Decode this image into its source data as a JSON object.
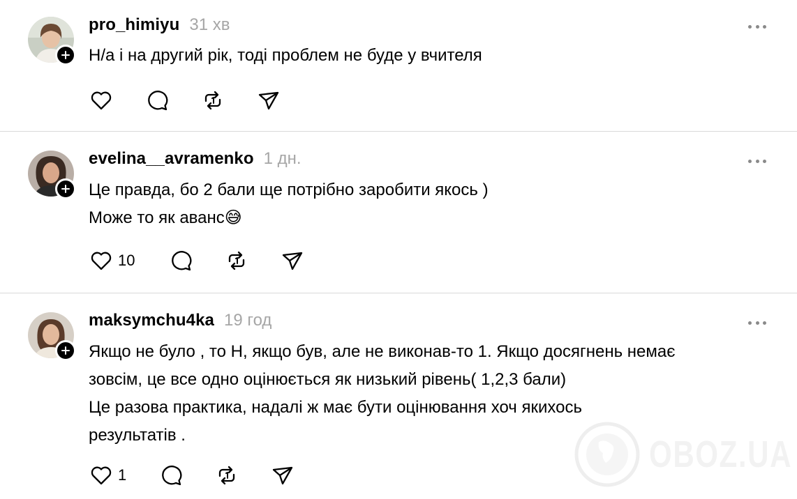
{
  "posts": [
    {
      "username": "pro_himiyu",
      "time": "31 хв",
      "lines": [
        "Н/а і на другий рік, тоді проблем не буде у вчителя"
      ],
      "likes": ""
    },
    {
      "username": "evelina__avramenko",
      "time": "1 дн.",
      "lines": [
        "Це правда, бо 2 бали ще потрібно заробити якось )",
        "Може то як аванс😅"
      ],
      "likes": "10"
    },
    {
      "username": "maksymchu4ka",
      "time": "19 год",
      "lines": [
        "Якщо не було , то Н, якщо був, але не виконав-то 1. Якщо досягнень немає",
        "зовсім, це все одно оцінюється як низький рівень( 1,2,3 бали)",
        "Це разова практика, надалі ж має бути оцінювання хоч якихось",
        "результатів ."
      ],
      "likes": "1"
    }
  ],
  "icons": {
    "like": "heart-icon",
    "comment": "comment-icon",
    "repost": "repost-icon",
    "share": "send-icon",
    "more": "more-icon",
    "follow": "plus-icon"
  },
  "watermark": {
    "text": "OBOZ.UA"
  },
  "colors": {
    "text": "#000000",
    "muted": "#a6a6a6",
    "divider": "#d9d9d9"
  }
}
